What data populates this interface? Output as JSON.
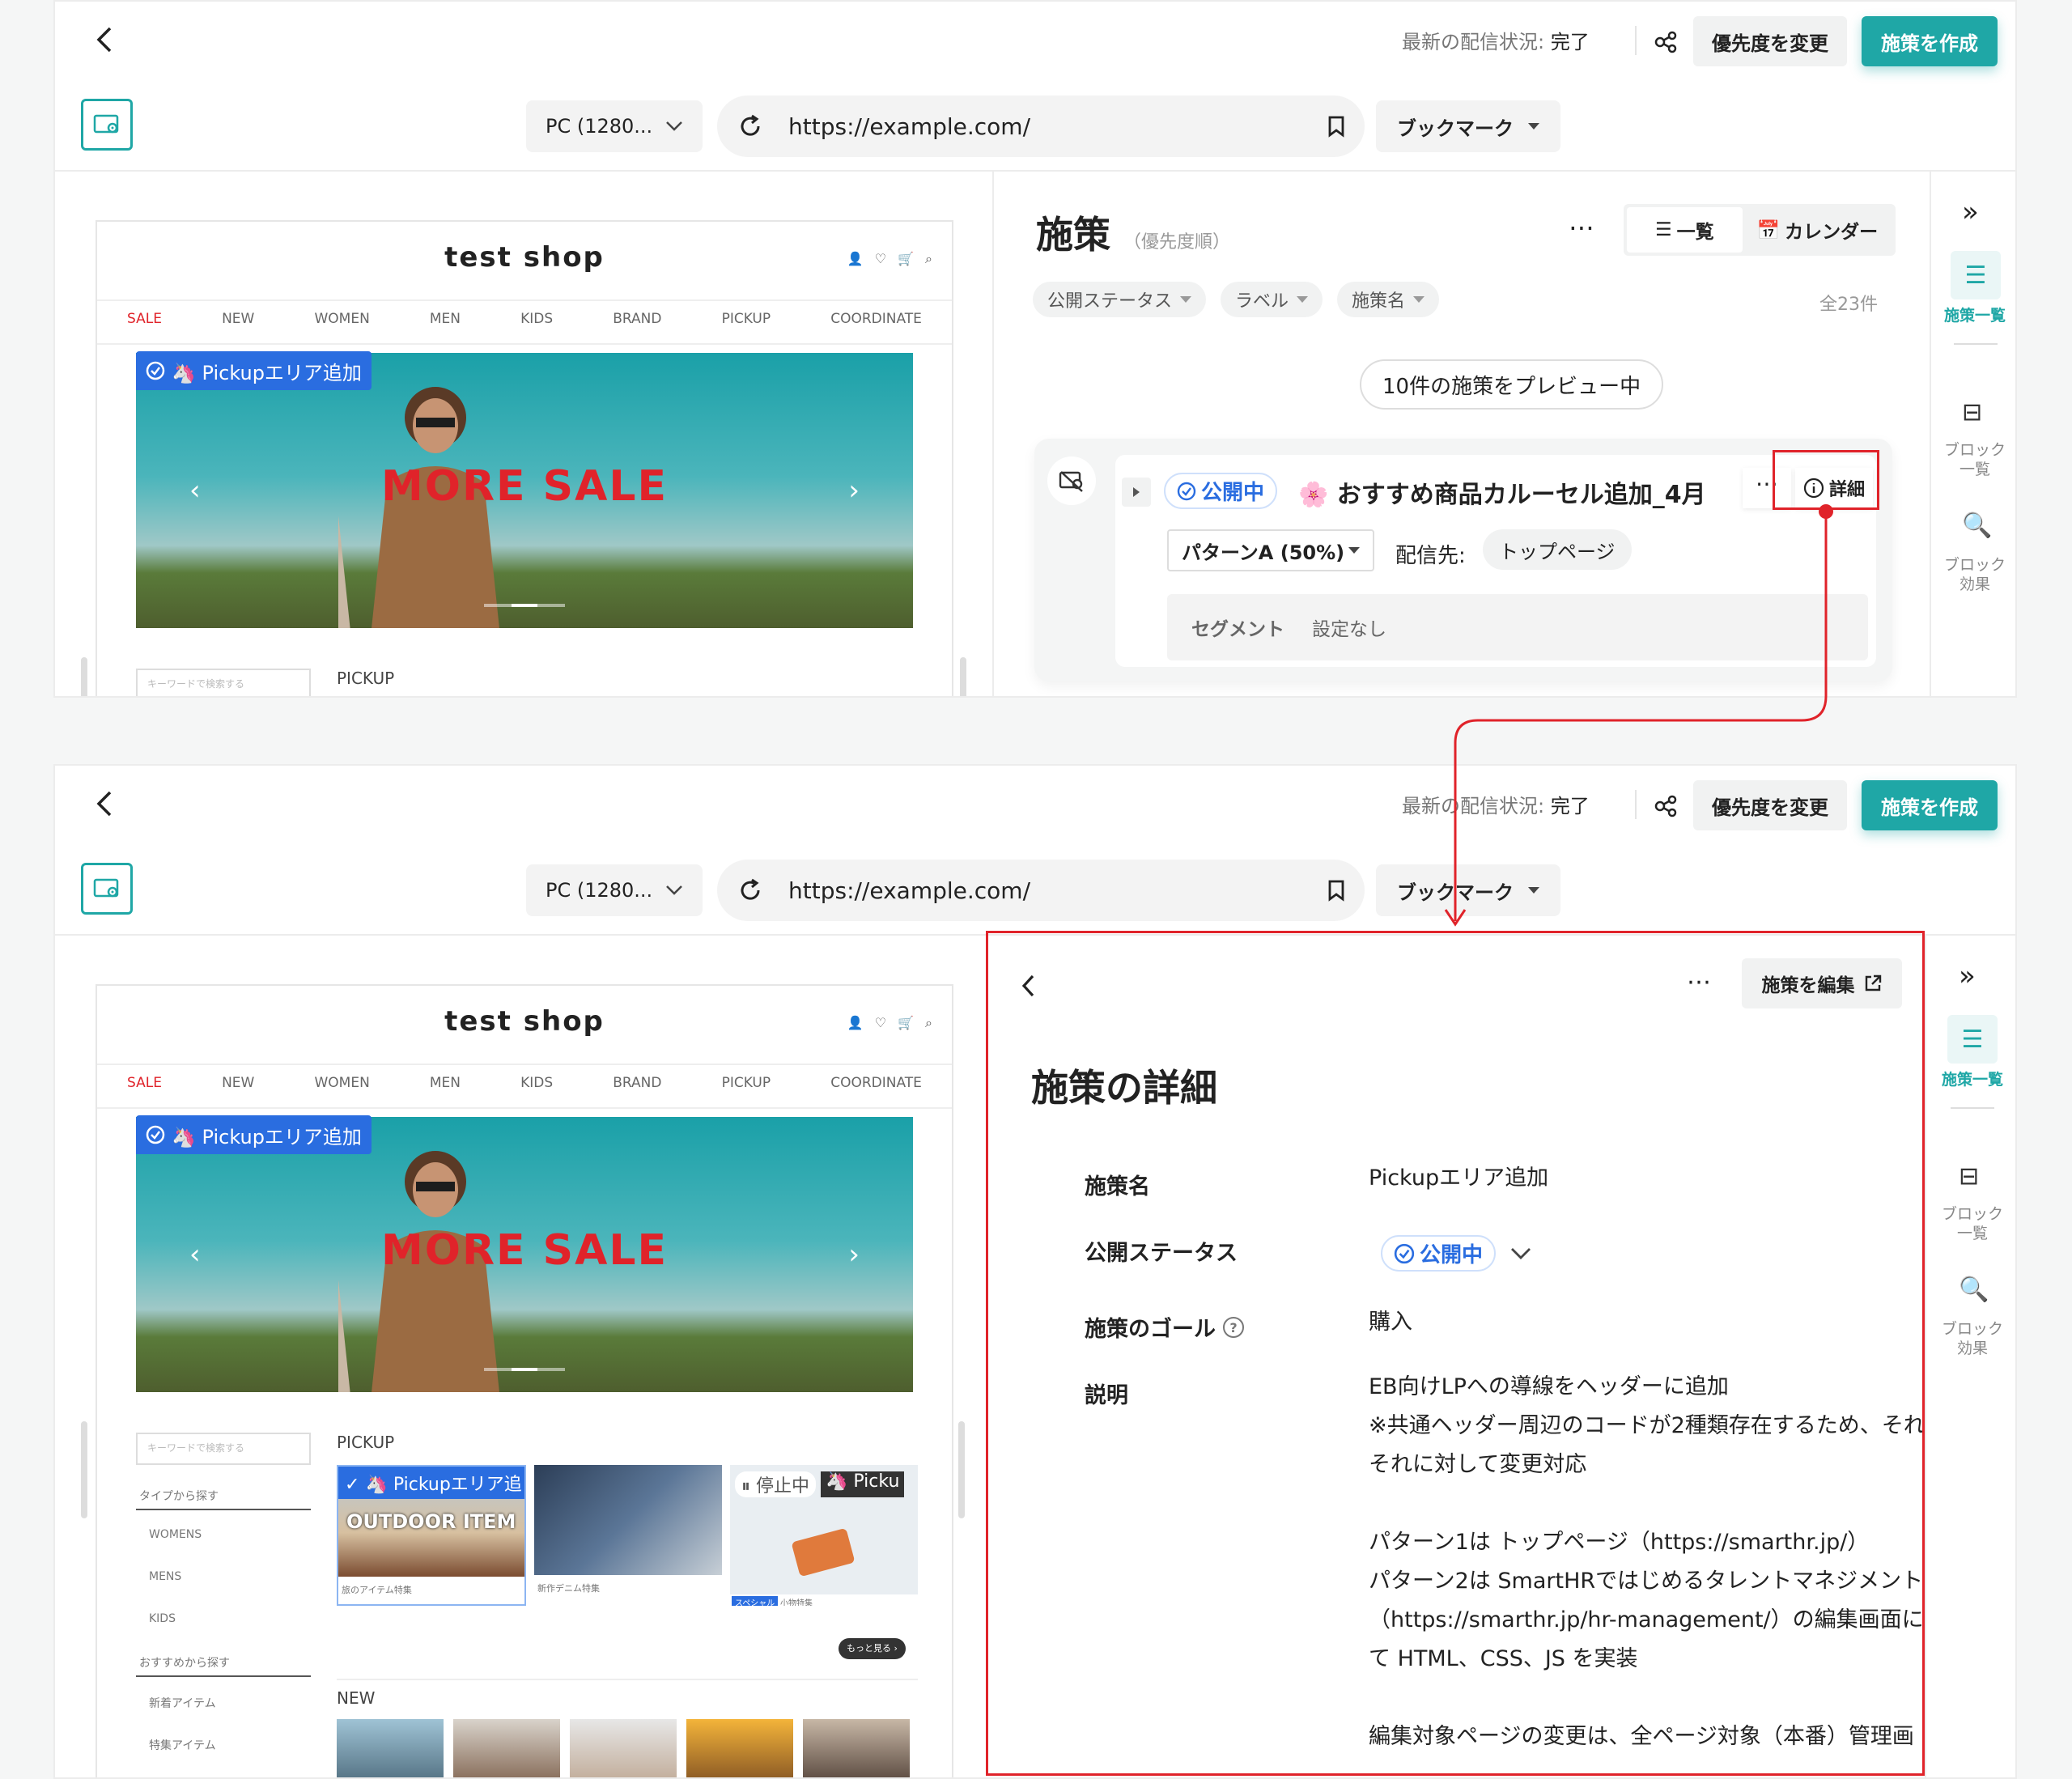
{
  "header": {
    "status_label": "最新の配信状況:",
    "status_value": "完了",
    "priority_button": "優先度を変更",
    "create_button": "施策を作成"
  },
  "toolbar": {
    "device": "PC (1280...",
    "url": "https://example.com/",
    "bookmark": "ブックマーク"
  },
  "shop": {
    "title": "test shop",
    "nav": [
      "SALE",
      "NEW",
      "WOMEN",
      "MEN",
      "KIDS",
      "BRAND",
      "PICKUP",
      "COORDINATE"
    ],
    "hero_text": "MORE SALE",
    "pickup_tag": "🦄 Pickupエリア追加",
    "search_placeholder": "キーワードで検索する",
    "pickup_heading": "PICKUP",
    "new_heading": "NEW",
    "filter_type": "タイプから探す",
    "filter_items": [
      "WOMENS",
      "MENS",
      "KIDS"
    ],
    "filter_recommend": "おすすめから探す",
    "recommend_items": [
      "新着アイテム",
      "特集アイテム"
    ],
    "cards": [
      {
        "tag": "🦄 Pickupエリア追",
        "overlay": "OUTDOOR ITEM",
        "caption": "旅のアイテム特集"
      },
      {
        "caption": "新作デニム特集"
      },
      {
        "tag_paused": "停止中",
        "tag2": "🦄 Picku",
        "badge": "スペシャル",
        "caption": "小物特集"
      }
    ],
    "more_button": "もっと見る ›"
  },
  "list_panel": {
    "title": "施策",
    "subtitle": "（優先度順）",
    "view_list": "一覧",
    "view_calendar": "カレンダー",
    "filters": [
      "公開ステータス",
      "ラベル",
      "施策名"
    ],
    "count": "全23件",
    "preview_pill": "10件の施策をプレビュー中",
    "card": {
      "status": "公開中",
      "name": "🌸 おすすめ商品カルーセル追加_4月",
      "detail_button": "詳細",
      "pattern": "パターンA (50%)",
      "target_label": "配信先:",
      "target_value": "トップページ",
      "segment_label": "セグメント",
      "segment_value": "設定なし"
    }
  },
  "right_sidebar": {
    "items": [
      "施策一覧",
      "ブロック\n一覧",
      "ブロック\n効果"
    ]
  },
  "detail_panel": {
    "edit_button": "施策を編集",
    "title": "施策の詳細",
    "name_label": "施策名",
    "name_value": "Pickupエリア追加",
    "status_label": "公開ステータス",
    "status_value": "公開中",
    "goal_label": "施策のゴール",
    "goal_value": "購入",
    "desc_label": "説明",
    "desc_lines": [
      "EB向けLPへの導線をヘッダーに追加",
      "※共通ヘッダー周辺のコードが2種類存在するため、それ",
      "それに対して変更対応",
      "",
      "パターン1は トップページ（https://smarthr.jp/）",
      "パターン2は SmartHRではじめるタレントマネジメント",
      "（https://smarthr.jp/hr-management/）の編集画面に",
      "て HTML、CSS、JS を実装",
      "",
      "編集対象ページの変更は、全ページ対象（本番）管理画"
    ]
  },
  "colors": {
    "teal": "#1fa7a6",
    "blue": "#2a6de0",
    "red": "#e0232a"
  }
}
